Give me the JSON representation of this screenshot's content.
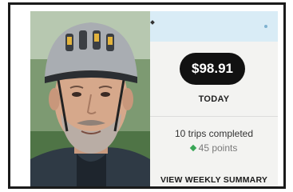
{
  "earnings": {
    "amount": "$98.91",
    "period": "TODAY"
  },
  "stats": {
    "trips": "10 trips completed",
    "points": "45 points"
  },
  "actions": {
    "weekly_summary": "VIEW WEEKLY SUMMARY"
  },
  "colors": {
    "pill": "#111111",
    "points_accent": "#3aa757",
    "header_strip": "#d9ecf6"
  },
  "icons": {
    "points": "diamond-icon"
  }
}
